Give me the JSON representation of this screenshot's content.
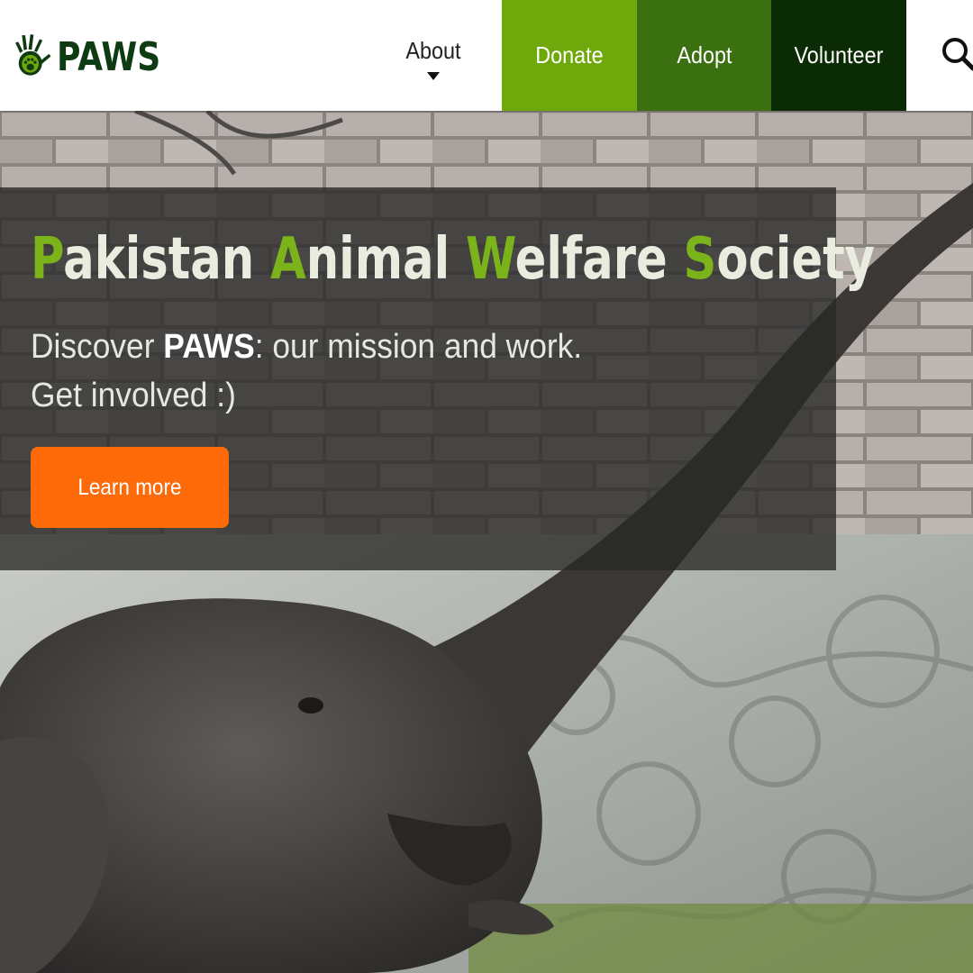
{
  "brand": {
    "name": "PAWS",
    "logo_icon": "handprint-paw-icon"
  },
  "nav": {
    "about": "About",
    "donate": "Donate",
    "adopt": "Adopt",
    "volunteer": "Volunteer",
    "search_icon": "search-icon"
  },
  "colors": {
    "donate_bg": "#6fa80b",
    "adopt_bg": "#3a7010",
    "volunteer_bg": "#0b2b05",
    "accent_green": "#7bb31b",
    "cta_orange": "#fd6a0a"
  },
  "hero": {
    "title_words": [
      {
        "initial": "P",
        "rest": "akistan"
      },
      {
        "initial": "A",
        "rest": "nimal"
      },
      {
        "initial": "W",
        "rest": "elfare"
      },
      {
        "initial": "S",
        "rest": "ociety"
      }
    ],
    "subtitle_before": "Discover ",
    "subtitle_bold": "PAWS",
    "subtitle_after": ": our mission and work.",
    "subtitle_line2": "Get involved :)",
    "cta": "Learn more",
    "background_image": "elephant-in-front-of-carved-stone-wall"
  }
}
